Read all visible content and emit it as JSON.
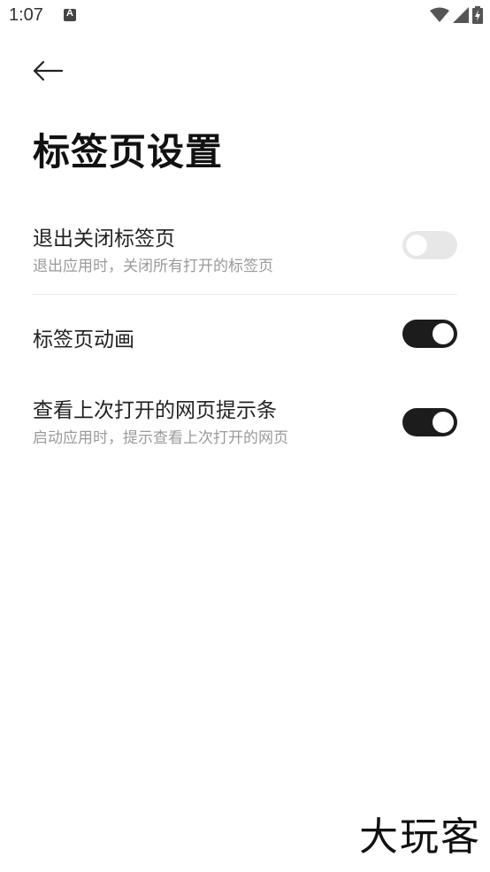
{
  "status_bar": {
    "time": "1:07",
    "notification_icon": "app-notification-icon",
    "icons": [
      "wifi-icon",
      "signal-icon",
      "battery-charging-icon"
    ]
  },
  "header": {
    "back_icon": "back-arrow-icon",
    "title": "标签页设置"
  },
  "settings": [
    {
      "title": "退出关闭标签页",
      "description": "退出应用时，关闭所有打开的标签页",
      "enabled": false
    },
    {
      "title": "标签页动画",
      "description": "",
      "enabled": true
    },
    {
      "title": "查看上次打开的网页提示条",
      "description": "启动应用时，提示查看上次打开的网页",
      "enabled": true
    }
  ],
  "watermark": "大玩客",
  "colors": {
    "toggle_on": "#1c1c1c",
    "toggle_off": "#e7e7e7",
    "description_text": "#9a9a9a"
  }
}
